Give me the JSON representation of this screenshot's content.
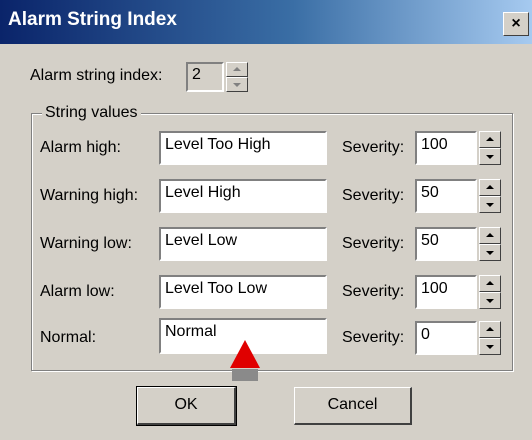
{
  "window": {
    "title": "Alarm String Index",
    "close_glyph": "×"
  },
  "index_field": {
    "label": "Alarm string index:",
    "value": "2"
  },
  "group": {
    "label": "String values"
  },
  "severity_label": "Severity:",
  "rows": [
    {
      "label": "Alarm high:",
      "value": "Level Too High",
      "severity": "100"
    },
    {
      "label": "Warning high:",
      "value": "Level High",
      "severity": "50"
    },
    {
      "label": "Warning low:",
      "value": "Level Low",
      "severity": "50"
    },
    {
      "label": "Alarm low:",
      "value": "Level Too Low",
      "severity": "100"
    },
    {
      "label": "Normal:",
      "value": "Normal",
      "severity": "0"
    }
  ],
  "buttons": {
    "ok": "OK",
    "cancel": "Cancel"
  },
  "colors": {
    "title_start": "#0a246a",
    "title_end": "#a6caf0",
    "face": "#d4d0c8",
    "cursor": "#e00000"
  },
  "icons": {
    "pointer": "red-triangle-cursor-icon"
  }
}
